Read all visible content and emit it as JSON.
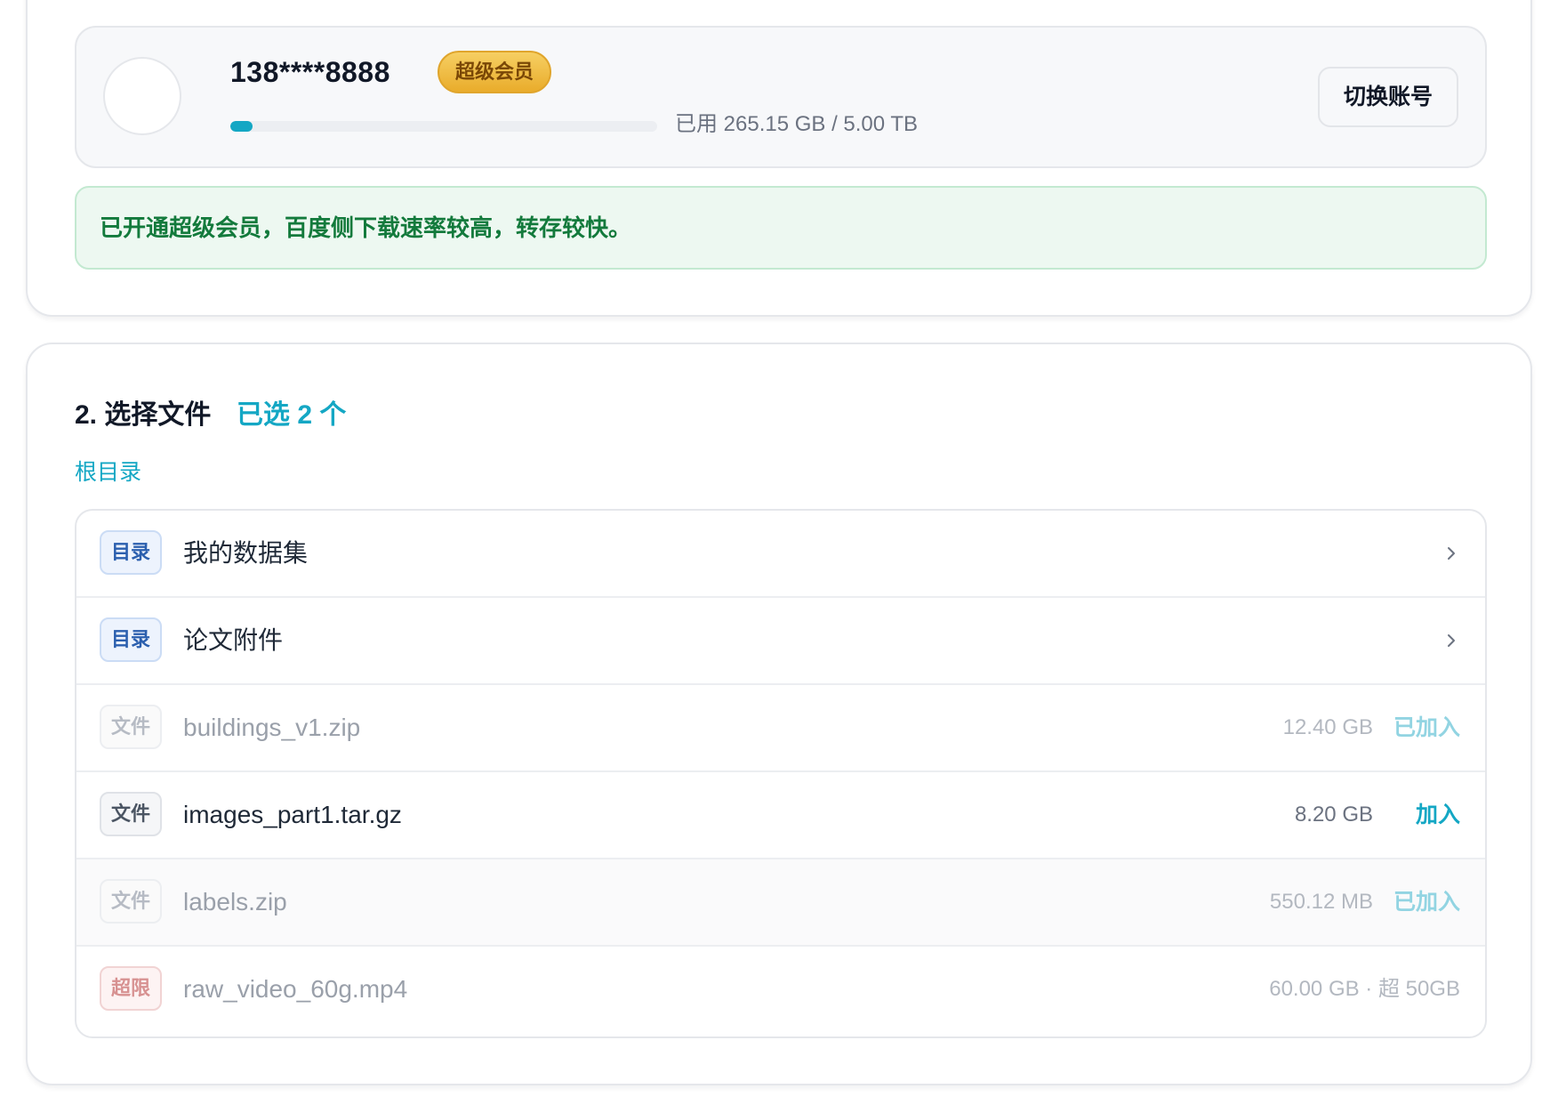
{
  "account": {
    "phone": "138****8888",
    "vip_label": "超级会员",
    "storage_used_fraction": 0.052,
    "storage_text": "已用 265.15 GB / 5.00 TB",
    "switch_label": "切换账号"
  },
  "notice": {
    "text": "已开通超级会员，百度侧下载速率较高，转存较快。"
  },
  "files_section": {
    "title": "2. 选择文件",
    "selected_count": "已选 2 个",
    "breadcrumb": "根目录",
    "rows": [
      {
        "type": "dir",
        "tag": "目录",
        "name": "我的数据集",
        "icon": "chevron-right-icon"
      },
      {
        "type": "dir",
        "tag": "目录",
        "name": "论文附件",
        "icon": "chevron-right-icon"
      },
      {
        "type": "file",
        "tag": "文件",
        "name": "buildings_v1.zip",
        "size": "12.40 GB",
        "action": "已加入",
        "state": "added"
      },
      {
        "type": "file",
        "tag": "文件",
        "name": "images_part1.tar.gz",
        "size": "8.20 GB",
        "action": "加入",
        "state": "available"
      },
      {
        "type": "file",
        "tag": "文件",
        "name": "labels.zip",
        "size": "550.12 MB",
        "action": "已加入",
        "state": "added"
      },
      {
        "type": "over",
        "tag": "超限",
        "name": "raw_video_60g.mp4",
        "size": "60.00 GB · 超 50GB",
        "state": "over-limit"
      }
    ]
  },
  "colors": {
    "accent": "#14a7c4",
    "vip_gold": "#e9ac2b",
    "notice_green": "#137a3c",
    "directory_blue": "#2b5fae",
    "over_limit_red": "#d79191"
  }
}
